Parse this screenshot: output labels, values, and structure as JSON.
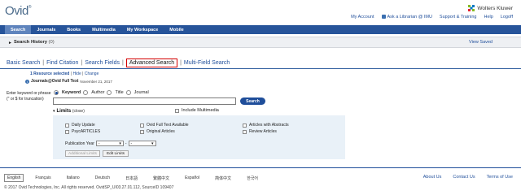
{
  "header": {
    "logo": "Ovid",
    "logo_mark": "®",
    "brand": "Wolters Kluwer",
    "util_links": [
      "My Account",
      "Ask a Librarian @ IMU",
      "Support & Training",
      "Help",
      "Logoff"
    ]
  },
  "nav": {
    "tabs": [
      "Search",
      "Journals",
      "Books",
      "Multimedia",
      "My Workspace",
      "Mobile"
    ],
    "active_index": 0
  },
  "history": {
    "label": "Search History",
    "count": "(0)",
    "view_saved": "View Saved"
  },
  "search_tabs": {
    "items": [
      "Basic Search",
      "Find Citation",
      "Search Fields",
      "Advanced Search",
      "Multi-Field Search"
    ],
    "active_index": 3,
    "highlight_color": "#d40000"
  },
  "resources": {
    "selected": "1 Resource selected",
    "hide": "Hide",
    "change": "Change",
    "name": "Journals@Ovid Full Text",
    "date": "November 21, 2017"
  },
  "query": {
    "label_line1": "Enter keyword or phrase",
    "label_line2": "(\" or $ for truncation)",
    "options": [
      "Keyword",
      "Author",
      "Title",
      "Journal"
    ],
    "selected_option": "Keyword",
    "value": "",
    "search_button": "Search"
  },
  "limits": {
    "title": "Limits",
    "close": "(close)",
    "include_multimedia": "Include Multimedia",
    "checkboxes": [
      "Daily Update",
      "Ovid Full Text Available",
      "Articles with Abstracts",
      "PsycARTICLES",
      "Original Articles",
      "Review Articles"
    ],
    "pub_year_label": "Publication Year",
    "pub_year_from": "-",
    "pub_year_to": "-",
    "add_limits_button": "Additional Limits",
    "edit_limits_button": "Edit Limits"
  },
  "footer": {
    "languages": [
      "English",
      "Français",
      "Italiano",
      "Deutsch",
      "日本語",
      "繁體中文",
      "Español",
      "简体中文",
      "한국어"
    ],
    "active_language": "English",
    "links": [
      "About Us",
      "Contact Us",
      "Terms of Use"
    ],
    "copyright": "© 2017 Ovid Technologies, Inc. All rights reserved.   OvidSP_UI03.27.01.112, SourceID 109407"
  },
  "colors": {
    "nav_bg": "#27549a",
    "link": "#1f4e9a",
    "limits_bg": "#e9f1f8"
  }
}
